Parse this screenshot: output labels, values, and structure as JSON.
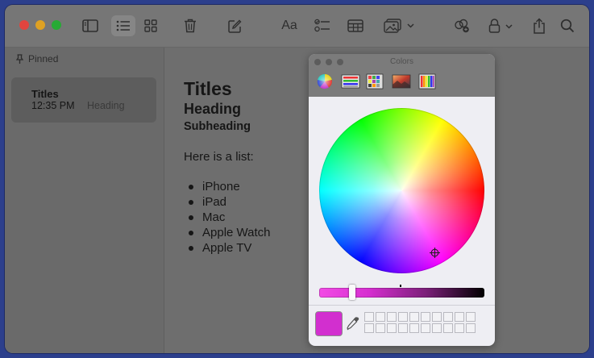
{
  "toolbar": {
    "buttons": [
      {
        "name": "sidebar-toggle-icon"
      },
      {
        "name": "list-view-icon",
        "active": true
      },
      {
        "name": "gallery-view-icon"
      },
      {
        "name": "trash-icon"
      },
      {
        "name": "compose-icon"
      },
      {
        "name": "format-icon",
        "label": "Aa"
      },
      {
        "name": "checklist-icon"
      },
      {
        "name": "table-icon"
      },
      {
        "name": "media-icon"
      },
      {
        "name": "collaborate-icon"
      },
      {
        "name": "lock-icon"
      },
      {
        "name": "share-icon"
      },
      {
        "name": "search-icon"
      }
    ],
    "format_label": "Aa"
  },
  "sidebar": {
    "section_label": "Pinned",
    "notes": [
      {
        "title": "Titles",
        "time": "12:35 PM",
        "preview": "Heading"
      }
    ]
  },
  "editor": {
    "title": "Titles",
    "heading": "Heading",
    "subheading": "Subheading",
    "text": "Here is a list:",
    "list": [
      "iPhone",
      "iPad",
      "Mac",
      "Apple Watch",
      "Apple TV"
    ]
  },
  "colors_panel": {
    "title": "Colors",
    "modes": [
      "color-wheel-icon",
      "color-sliders-icon",
      "color-palettes-icon",
      "image-palettes-icon",
      "pencils-icon"
    ],
    "current_color": "#d22fcf",
    "brightness": 0.2
  }
}
